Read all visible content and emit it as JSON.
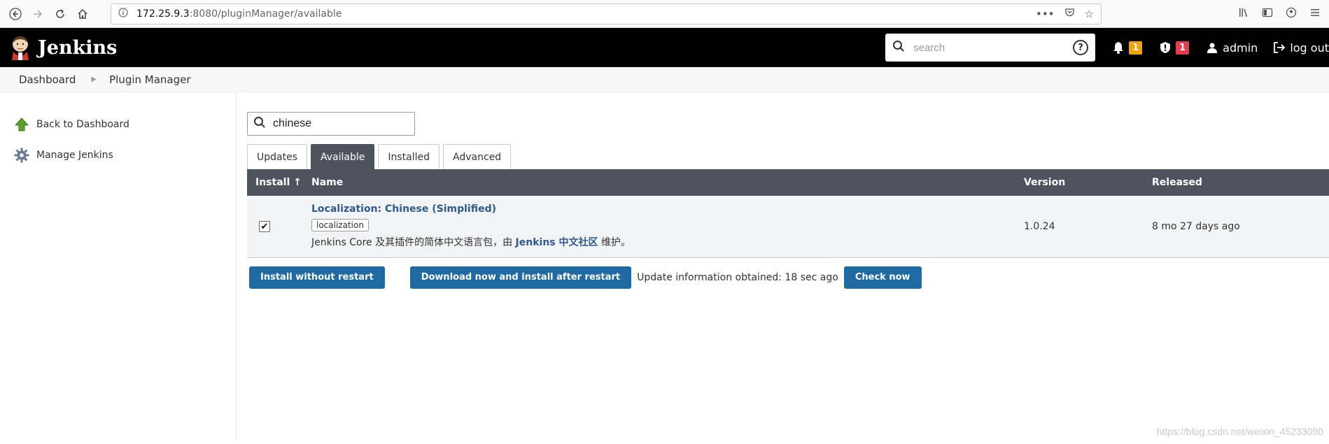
{
  "browser": {
    "url_host": "172.25.9.3",
    "url_rest": ":8080/pluginManager/available",
    "icons": [
      "back-icon",
      "forward-icon",
      "reload-icon",
      "home-icon",
      "info-icon",
      "more-icon",
      "pocket-icon",
      "bookmark-star-icon",
      "library-icon",
      "sidebar-icon",
      "account-icon",
      "menu-icon"
    ]
  },
  "header": {
    "logo_text": "Jenkins",
    "search_placeholder": "search",
    "notifications_count": "1",
    "security_count": "1",
    "user": "admin",
    "logout": "log out",
    "colors": {
      "bg": "#000000",
      "orange_badge": "#f0a30a",
      "red_badge": "#e33e4f"
    }
  },
  "breadcrumb": {
    "items": [
      "Dashboard",
      "Plugin Manager"
    ]
  },
  "sidebar": {
    "items": [
      {
        "label": "Back to Dashboard",
        "icon": "up-arrow-icon"
      },
      {
        "label": "Manage Jenkins",
        "icon": "gear-icon"
      }
    ]
  },
  "main": {
    "filter_value": "chinese",
    "tabs": [
      "Updates",
      "Available",
      "Installed",
      "Advanced"
    ],
    "active_tab": "Available",
    "table": {
      "headers": [
        "Install ↑",
        "Name",
        "Version",
        "Released"
      ],
      "rows": [
        {
          "checked": true,
          "name": "Localization: Chinese (Simplified)",
          "label": "localization",
          "desc_prefix": "Jenkins Core 及其插件的简体中文语言包，由 ",
          "desc_link": "Jenkins 中文社区",
          "desc_suffix": " 维护。",
          "version": "1.0.24",
          "released": "8 mo 27 days ago"
        }
      ]
    },
    "buttons": {
      "install_now": "Install without restart",
      "download_later": "Download now and install after restart",
      "update_info": "Update information obtained: 18 sec ago",
      "check_now": "Check now"
    },
    "accent_color": "#1f6aa3"
  },
  "watermark": "https://blog.csdn.net/weixin_45233090"
}
